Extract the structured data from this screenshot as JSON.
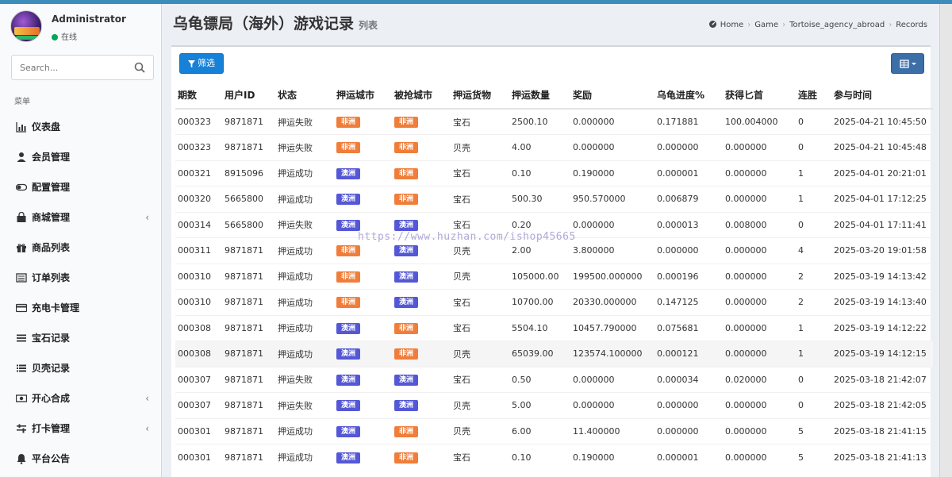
{
  "user": {
    "name": "Administrator",
    "status": "在线"
  },
  "search": {
    "placeholder": "Search..."
  },
  "menu_header": "菜单",
  "menu": [
    {
      "label": "仪表盘",
      "icon": "bar-chart-icon",
      "expandable": false
    },
    {
      "label": "会员管理",
      "icon": "user-icon",
      "expandable": false
    },
    {
      "label": "配置管理",
      "icon": "toggle-icon",
      "expandable": false
    },
    {
      "label": "商城管理",
      "icon": "shopping-bag-icon",
      "expandable": true
    },
    {
      "label": "商品列表",
      "icon": "gift-icon",
      "expandable": false
    },
    {
      "label": "订单列表",
      "icon": "list-alt-icon",
      "expandable": false
    },
    {
      "label": "充电卡管理",
      "icon": "credit-card-icon",
      "expandable": false
    },
    {
      "label": "宝石记录",
      "icon": "bars-icon",
      "expandable": false
    },
    {
      "label": "贝壳记录",
      "icon": "list-icon",
      "expandable": false
    },
    {
      "label": "开心合成",
      "icon": "money-icon",
      "expandable": true
    },
    {
      "label": "打卡管理",
      "icon": "sliders-icon",
      "expandable": true
    },
    {
      "label": "平台公告",
      "icon": "bell-icon",
      "expandable": false
    }
  ],
  "chevron_glyph": "‹",
  "page": {
    "title": "乌龟镖局（海外）游戏记录",
    "subtitle": "列表"
  },
  "breadcrumb": [
    "Home",
    "Game",
    "Tortoise_agency_abroad",
    "Records"
  ],
  "toolbar": {
    "filter_label": "筛选"
  },
  "table": {
    "columns": [
      "期数",
      "用户ID",
      "状态",
      "押运城市",
      "被抢城市",
      "押运货物",
      "押运数量",
      "奖励",
      "乌龟进度%",
      "获得匕首",
      "连胜",
      "参与时间"
    ],
    "badge_colors": {
      "非洲": "#f07e3a",
      "澳洲": "#5457d6"
    },
    "rows": [
      [
        "000323",
        "9871871",
        "押运失败",
        "非洲",
        "非洲",
        "宝石",
        "2500.10",
        "0.000000",
        "0.171881",
        "100.004000",
        "0",
        "2025-04-21 10:45:50"
      ],
      [
        "000323",
        "9871871",
        "押运失败",
        "非洲",
        "非洲",
        "贝壳",
        "4.00",
        "0.000000",
        "0.000000",
        "0.000000",
        "0",
        "2025-04-21 10:45:48"
      ],
      [
        "000321",
        "8915096",
        "押运成功",
        "澳洲",
        "非洲",
        "宝石",
        "0.10",
        "0.190000",
        "0.000001",
        "0.000000",
        "1",
        "2025-04-01 20:21:01"
      ],
      [
        "000320",
        "5665800",
        "押运成功",
        "澳洲",
        "非洲",
        "宝石",
        "500.30",
        "950.570000",
        "0.006879",
        "0.000000",
        "1",
        "2025-04-01 17:12:25"
      ],
      [
        "000314",
        "5665800",
        "押运失败",
        "澳洲",
        "澳洲",
        "宝石",
        "0.20",
        "0.000000",
        "0.000013",
        "0.008000",
        "0",
        "2025-04-01 17:11:41"
      ],
      [
        "000311",
        "9871871",
        "押运成功",
        "非洲",
        "澳洲",
        "贝壳",
        "2.00",
        "3.800000",
        "0.000000",
        "0.000000",
        "4",
        "2025-03-20 19:01:58"
      ],
      [
        "000310",
        "9871871",
        "押运成功",
        "非洲",
        "澳洲",
        "贝壳",
        "105000.00",
        "199500.000000",
        "0.000196",
        "0.000000",
        "2",
        "2025-03-19 14:13:42"
      ],
      [
        "000310",
        "9871871",
        "押运成功",
        "非洲",
        "澳洲",
        "宝石",
        "10700.00",
        "20330.000000",
        "0.147125",
        "0.000000",
        "2",
        "2025-03-19 14:13:40"
      ],
      [
        "000308",
        "9871871",
        "押运成功",
        "澳洲",
        "非洲",
        "宝石",
        "5504.10",
        "10457.790000",
        "0.075681",
        "0.000000",
        "1",
        "2025-03-19 14:12:22"
      ],
      [
        "000308",
        "9871871",
        "押运成功",
        "澳洲",
        "非洲",
        "贝壳",
        "65039.00",
        "123574.100000",
        "0.000121",
        "0.000000",
        "1",
        "2025-03-19 14:12:15"
      ],
      [
        "000307",
        "9871871",
        "押运失败",
        "澳洲",
        "澳洲",
        "宝石",
        "0.50",
        "0.000000",
        "0.000034",
        "0.020000",
        "0",
        "2025-03-18 21:42:07"
      ],
      [
        "000307",
        "9871871",
        "押运失败",
        "澳洲",
        "澳洲",
        "贝壳",
        "5.00",
        "0.000000",
        "0.000000",
        "0.000000",
        "0",
        "2025-03-18 21:42:05"
      ],
      [
        "000301",
        "9871871",
        "押运成功",
        "澳洲",
        "非洲",
        "贝壳",
        "6.00",
        "11.400000",
        "0.000000",
        "0.000000",
        "5",
        "2025-03-18 21:41:15"
      ],
      [
        "000301",
        "9871871",
        "押运成功",
        "澳洲",
        "非洲",
        "宝石",
        "0.10",
        "0.190000",
        "0.000001",
        "0.000000",
        "5",
        "2025-03-18 21:41:13"
      ]
    ]
  },
  "watermark": "https://www.huzhan.com/ishop45665"
}
